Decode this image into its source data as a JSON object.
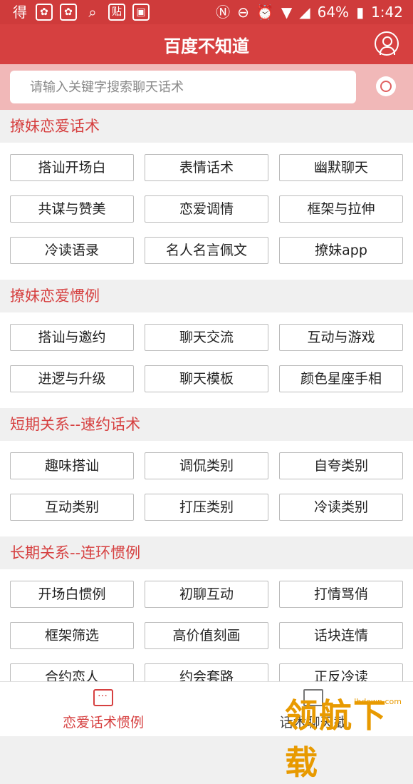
{
  "status_bar": {
    "left_icons": [
      "得",
      "app-icon-a",
      "app-icon-b",
      "search-icon",
      "贴",
      "image-icon"
    ],
    "battery": "64%",
    "time": "1:42"
  },
  "header": {
    "title": "百度不知道",
    "user_icon": "user-icon"
  },
  "search": {
    "placeholder": "请输入关键字搜索聊天话术",
    "camera_icon": "camera-icon"
  },
  "sections": [
    {
      "title": "撩妹恋爱话术",
      "items": [
        "搭讪开场白",
        "表情话术",
        "幽默聊天",
        "共谋与赞美",
        "恋爱调情",
        "框架与拉伸",
        "冷读语录",
        "名人名言佩文",
        "撩妹app"
      ]
    },
    {
      "title": "撩妹恋爱惯例",
      "items": [
        "搭讪与邀约",
        "聊天交流",
        "互动与游戏",
        "进逻与升级",
        "聊天模板",
        "颜色星座手相"
      ]
    },
    {
      "title": "短期关系--速约话术",
      "items": [
        "趣味搭讪",
        "调侃类别",
        "自夸类别",
        "互动类别",
        "打压类别",
        "冷读类别"
      ]
    },
    {
      "title": "长期关系--连环惯例",
      "items": [
        "开场白惯例",
        "初聊互动",
        "打情骂俏",
        "框架筛选",
        "高价值刻画",
        "话块连情",
        "合约恋人",
        "约会套路",
        "正反冷读"
      ]
    }
  ],
  "bottom_nav": {
    "tab1": "恋爱话术惯例",
    "tab2": "话术聊天截"
  },
  "watermark": {
    "main": "领航下载",
    "url": "lhdown.com"
  },
  "colors": {
    "primary": "#d64040",
    "search_bg": "#f1b8b8"
  }
}
